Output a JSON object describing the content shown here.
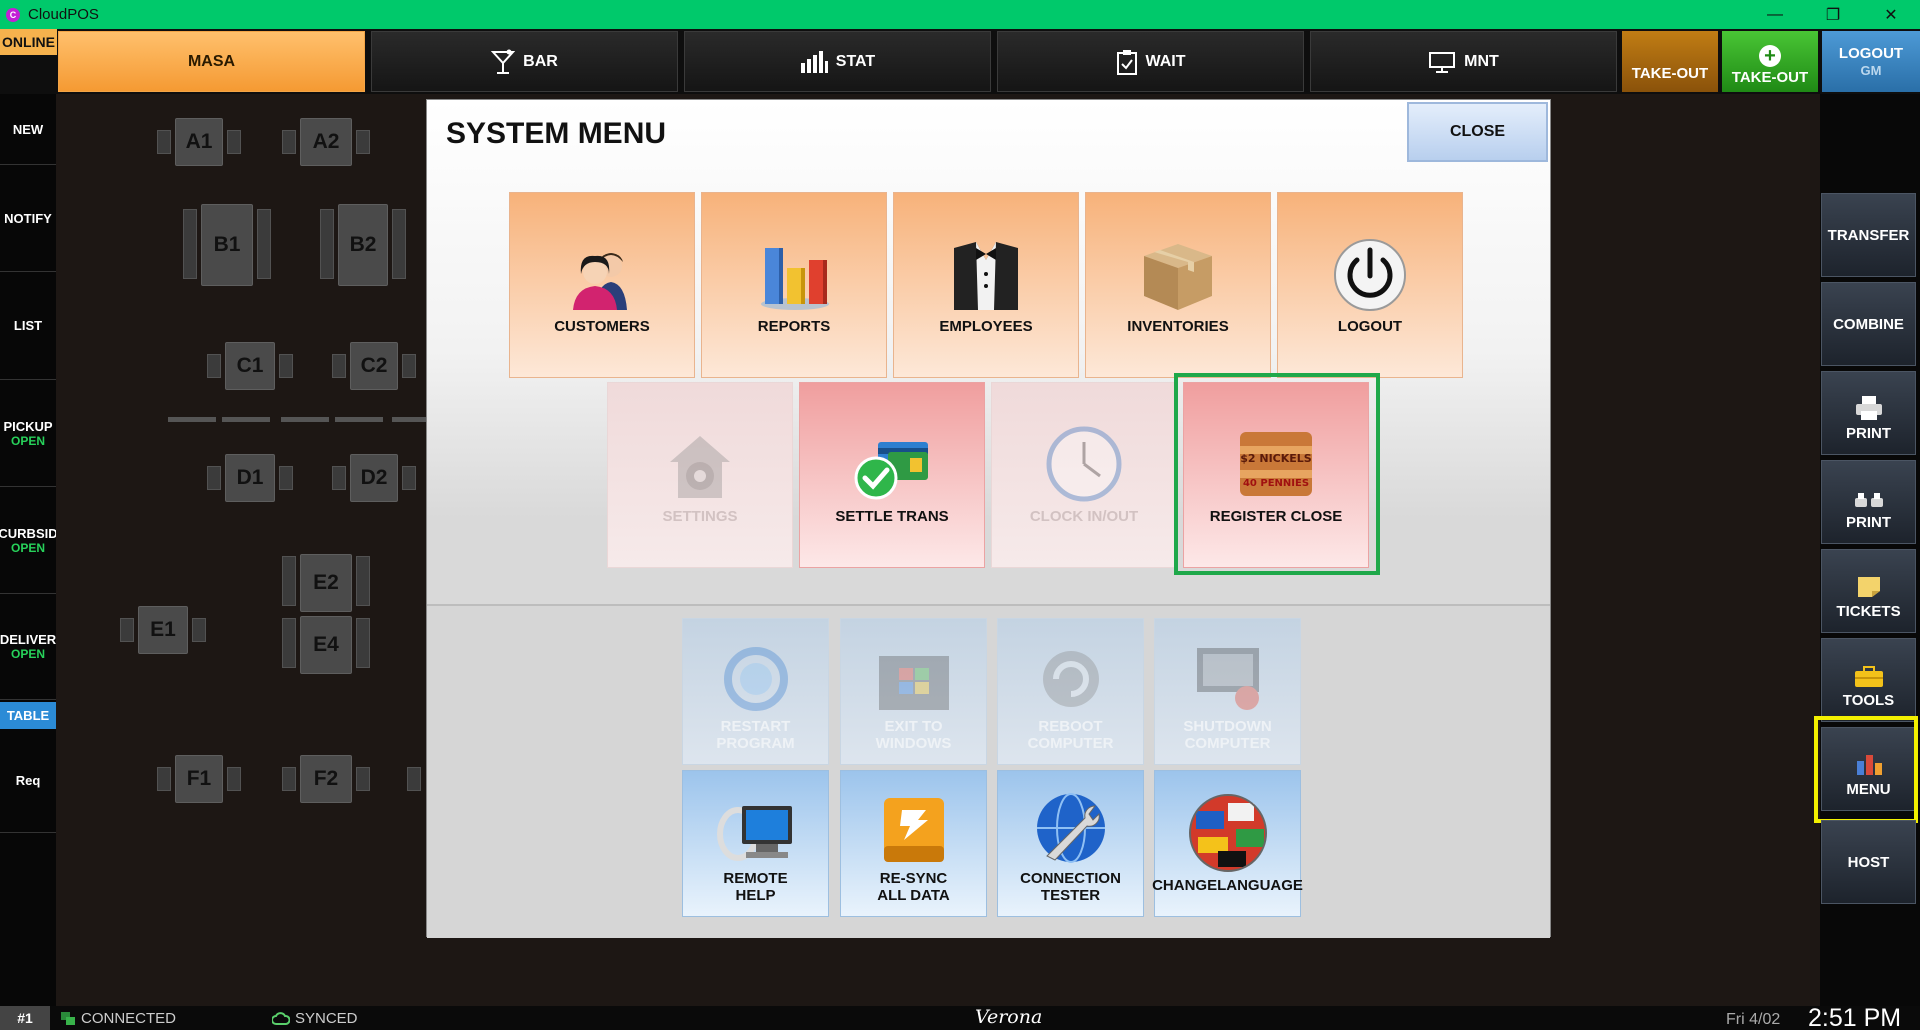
{
  "window": {
    "title": "CloudPOS",
    "app_icon": "cloudpos-logo-icon",
    "controls": [
      "minimize",
      "restore",
      "close"
    ]
  },
  "topnav": {
    "online_label": "ONLINE",
    "tabs": [
      {
        "label": "MASA",
        "icon": "",
        "active": true
      },
      {
        "label": "BAR",
        "icon": "cocktail-icon",
        "active": false
      },
      {
        "label": "STAT",
        "icon": "bar-chart-icon",
        "active": false
      },
      {
        "label": "WAIT",
        "icon": "clipboard-icon",
        "active": false
      },
      {
        "label": "MNT",
        "icon": "monitor-icon",
        "active": false
      }
    ],
    "takeout_label": "TAKE-OUT",
    "add_takeout_label": "TAKE-OUT",
    "logout_label": "LOGOUT",
    "logout_user": "GM"
  },
  "leftbar": {
    "items": [
      {
        "label": "NEW",
        "status": ""
      },
      {
        "label": "NOTIFY",
        "status": ""
      },
      {
        "label": "LIST",
        "status": ""
      },
      {
        "label": "PICKUP",
        "status": "OPEN"
      },
      {
        "label": "CURBSID",
        "status": "OPEN"
      },
      {
        "label": "DELIVER",
        "status": "OPEN"
      },
      {
        "label": "TABLE",
        "status": ""
      },
      {
        "label": "Req",
        "status": ""
      }
    ]
  },
  "floor": {
    "tables": [
      "A1",
      "A2",
      "B1",
      "B2",
      "C1",
      "C2",
      "D1",
      "D2",
      "E1",
      "E2",
      "E4",
      "F1",
      "F2"
    ]
  },
  "rightbar": {
    "items": [
      {
        "label": "TRANSFER",
        "icon": ""
      },
      {
        "label": "COMBINE",
        "icon": ""
      },
      {
        "label": "PRINT",
        "icon": "printer-icon"
      },
      {
        "label": "PRINT",
        "icon": "kitchen-printer-icon"
      },
      {
        "label": "TICKETS",
        "icon": "sticky-note-icon"
      },
      {
        "label": "TOOLS",
        "icon": "toolbox-icon"
      },
      {
        "label": "MENU",
        "icon": "menu-chart-icon"
      },
      {
        "label": "HOST",
        "icon": ""
      }
    ]
  },
  "modal": {
    "title": "SYSTEM MENU",
    "close_label": "CLOSE",
    "primary_tiles": [
      {
        "label": "CUSTOMERS",
        "icon": "customers-icon"
      },
      {
        "label": "REPORTS",
        "icon": "reports-icon"
      },
      {
        "label": "EMPLOYEES",
        "icon": "tuxedo-icon"
      },
      {
        "label": "INVENTORIES",
        "icon": "box-icon"
      },
      {
        "label": "LOGOUT",
        "icon": "power-icon"
      }
    ],
    "secondary_tiles": [
      {
        "label": "SETTINGS",
        "icon": "gear-house-icon",
        "disabled": true
      },
      {
        "label": "SETTLE TRANS",
        "icon": "settle-card-icon",
        "disabled": false
      },
      {
        "label": "CLOCK IN/OUT",
        "icon": "clock-icon",
        "disabled": true
      },
      {
        "label": "REGISTER CLOSE",
        "icon": "coin-roll-icon",
        "disabled": false,
        "highlighted": true
      }
    ],
    "system_tiles": [
      {
        "line1": "RESTART",
        "line2": "PROGRAM",
        "icon": "restart-icon",
        "disabled": true
      },
      {
        "line1": "EXIT TO",
        "line2": "WINDOWS",
        "icon": "windows-icon",
        "disabled": true
      },
      {
        "line1": "REBOOT",
        "line2": "COMPUTER",
        "icon": "reboot-icon",
        "disabled": true
      },
      {
        "line1": "SHUTDOWN",
        "line2": "COMPUTER",
        "icon": "shutdown-icon",
        "disabled": true
      },
      {
        "line1": "REMOTE",
        "line2": "HELP",
        "icon": "remote-help-icon",
        "disabled": false
      },
      {
        "line1": "RE-SYNC",
        "line2": "ALL DATA",
        "icon": "resync-icon",
        "disabled": false
      },
      {
        "line1": "CONNECTION",
        "line2": "TESTER",
        "icon": "globe-wrench-icon",
        "disabled": false
      },
      {
        "line1": "CHANGELANGUAGE",
        "line2": "",
        "icon": "flags-globe-icon",
        "disabled": false
      }
    ]
  },
  "statusbar": {
    "station": "#1",
    "connection": "CONNECTED",
    "sync": "SYNCED",
    "location": "Verona",
    "date": "Fri 4/02",
    "time": "2:51 PM"
  },
  "colors": {
    "titlebar": "#00c96b",
    "active_tab": "#f59a33",
    "highlight_menu": "#f3f000",
    "highlight_tile": "#1fa84a",
    "open_status": "#27d15a"
  }
}
